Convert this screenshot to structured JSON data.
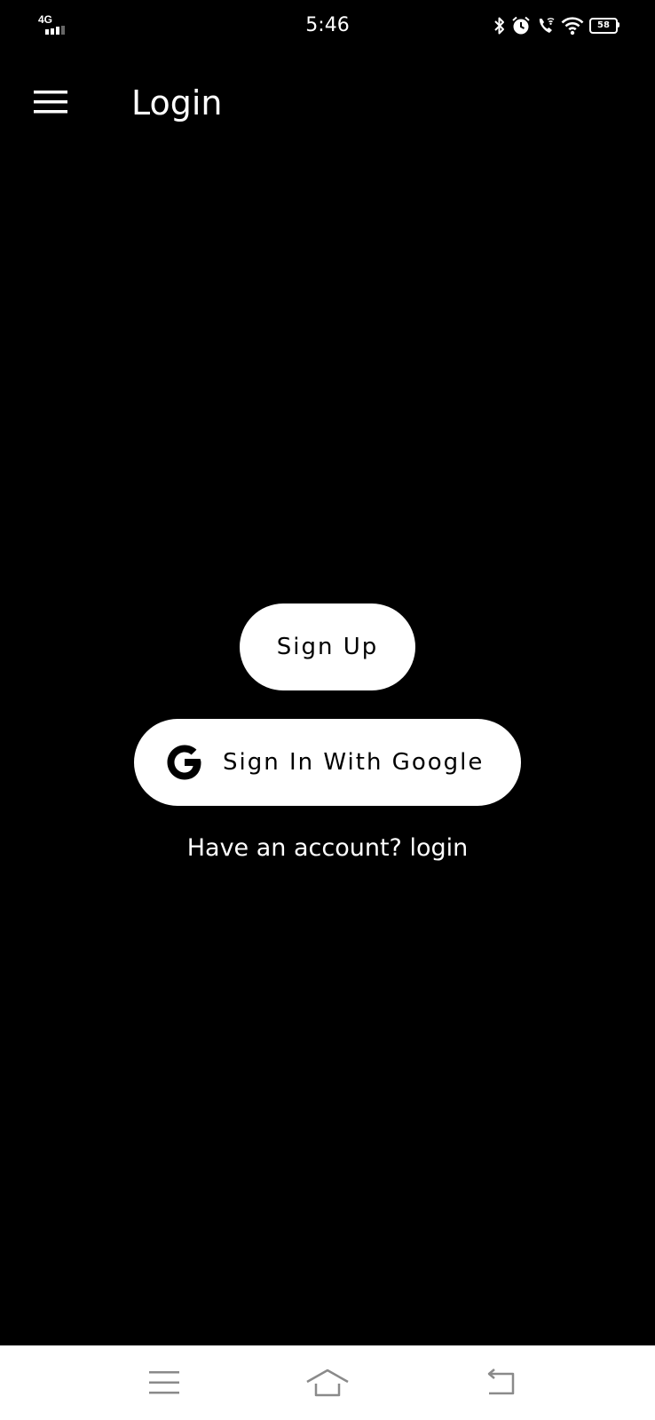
{
  "status_bar": {
    "network": "4G",
    "time": "5:46",
    "battery": "58",
    "icons": [
      "signal-icon",
      "bluetooth-icon",
      "alarm-icon",
      "wifi-calling-icon",
      "wifi-icon",
      "battery-icon"
    ]
  },
  "app_bar": {
    "title": "Login",
    "menu_icon": "hamburger-menu-icon"
  },
  "main": {
    "signup_label": "Sign Up",
    "google_label": "Sign In With Google",
    "google_icon": "google-icon",
    "login_prompt": "Have an account? login"
  },
  "colors": {
    "background": "#000000",
    "button_background": "#ffffff",
    "button_text": "#000000",
    "text": "#ffffff",
    "nav_background": "#ffffff",
    "nav_icon": "#8a8a8a"
  },
  "nav_bar": {
    "icons": [
      "recent-apps-icon",
      "home-icon",
      "back-icon"
    ]
  }
}
